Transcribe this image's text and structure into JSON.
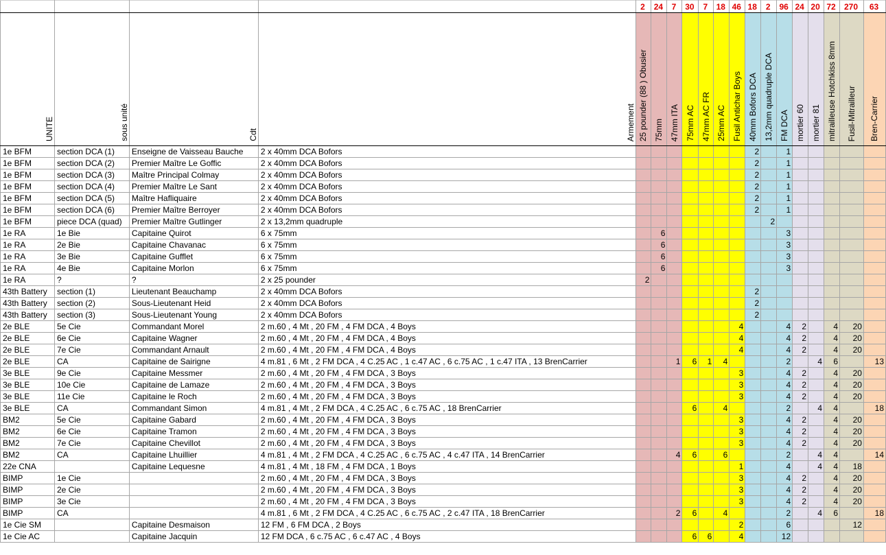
{
  "colors": {
    "pink": "#e6b8b7",
    "yellow": "#ffff00",
    "blue": "#b7dee8",
    "lavender": "#e4dfec",
    "tan": "#ddd9c4",
    "orange": "#fcd5b4",
    "totals": "#e00000"
  },
  "headers": {
    "unite": "UNITE",
    "sous_unite": "sous unité",
    "cdt": "Cdt",
    "armement": "Armement"
  },
  "weapons": [
    {
      "label": "25 pounder (88 ) Obusier",
      "total": "2",
      "color": "pink"
    },
    {
      "label": "75mm",
      "total": "24",
      "color": "pink"
    },
    {
      "label": "47mm ITA",
      "total": "7",
      "color": "pink"
    },
    {
      "label": "75mm AC",
      "total": "30",
      "color": "yellow"
    },
    {
      "label": "47mm AC FR",
      "total": "7",
      "color": "yellow"
    },
    {
      "label": "25mm AC",
      "total": "18",
      "color": "yellow"
    },
    {
      "label": "Fusil Antichar Boys",
      "total": "46",
      "color": "yellow"
    },
    {
      "label": "40mm Bofors DCA",
      "total": "18",
      "color": "blue"
    },
    {
      "label": "13,2mm quadruple DCA",
      "total": "2",
      "color": "blue"
    },
    {
      "label": "FM DCA",
      "total": "96",
      "color": "blue"
    },
    {
      "label": "mortier 60",
      "total": "24",
      "color": "lavender"
    },
    {
      "label": "mortier 81",
      "total": "20",
      "color": "lavender"
    },
    {
      "label": "mitrailleuse Hotchkiss 8mm",
      "total": "72",
      "color": "tan"
    },
    {
      "label": "Fusil-Mitrailleur",
      "total": "270",
      "color": "tan"
    },
    {
      "label": "Bren-Carrier",
      "total": "63",
      "color": "orange"
    }
  ],
  "rows": [
    {
      "unite": "1e BFM",
      "sous": "section DCA (1)",
      "cdt": "Enseigne de Vaisseau Bauche",
      "arm": "2 x 40mm DCA Bofors",
      "v": [
        "",
        "",
        "",
        "",
        "",
        "",
        "",
        "2",
        "",
        "1",
        "",
        "",
        "",
        "",
        ""
      ]
    },
    {
      "unite": "1e BFM",
      "sous": "section DCA (2)",
      "cdt": "Premier Maître Le Goffic",
      "arm": "2 x 40mm DCA Bofors",
      "v": [
        "",
        "",
        "",
        "",
        "",
        "",
        "",
        "2",
        "",
        "1",
        "",
        "",
        "",
        "",
        ""
      ]
    },
    {
      "unite": "1e BFM",
      "sous": "section DCA (3)",
      "cdt": "Maître Principal Colmay",
      "arm": "2 x 40mm DCA Bofors",
      "v": [
        "",
        "",
        "",
        "",
        "",
        "",
        "",
        "2",
        "",
        "1",
        "",
        "",
        "",
        "",
        ""
      ]
    },
    {
      "unite": "1e BFM",
      "sous": "section DCA (4)",
      "cdt": "Premier Maître Le Sant",
      "arm": "2 x 40mm DCA Bofors",
      "v": [
        "",
        "",
        "",
        "",
        "",
        "",
        "",
        "2",
        "",
        "1",
        "",
        "",
        "",
        "",
        ""
      ]
    },
    {
      "unite": "1e BFM",
      "sous": "section DCA (5)",
      "cdt": "Maître Hafliquaire",
      "arm": "2 x 40mm DCA Bofors",
      "v": [
        "",
        "",
        "",
        "",
        "",
        "",
        "",
        "2",
        "",
        "1",
        "",
        "",
        "",
        "",
        ""
      ]
    },
    {
      "unite": "1e BFM",
      "sous": "section DCA (6)",
      "cdt": "Premier Maître Berroyer",
      "arm": "2 x 40mm DCA Bofors",
      "v": [
        "",
        "",
        "",
        "",
        "",
        "",
        "",
        "2",
        "",
        "1",
        "",
        "",
        "",
        "",
        ""
      ]
    },
    {
      "unite": "1e BFM",
      "sous": "piece DCA (quad)",
      "cdt": "Premier Maître Gutlinger",
      "arm": "2 x 13,2mm quadruple",
      "v": [
        "",
        "",
        "",
        "",
        "",
        "",
        "",
        "",
        "2",
        "",
        "",
        "",
        "",
        "",
        ""
      ]
    },
    {
      "unite": "1e RA",
      "sous": "1e Bie",
      "cdt": "Capitaine Quirot",
      "arm": "6 x 75mm",
      "v": [
        "",
        "6",
        "",
        "",
        "",
        "",
        "",
        "",
        "",
        "3",
        "",
        "",
        "",
        "",
        ""
      ]
    },
    {
      "unite": "1e RA",
      "sous": "2e Bie",
      "cdt": "Capitaine Chavanac",
      "arm": "6 x 75mm",
      "v": [
        "",
        "6",
        "",
        "",
        "",
        "",
        "",
        "",
        "",
        "3",
        "",
        "",
        "",
        "",
        ""
      ]
    },
    {
      "unite": "1e RA",
      "sous": "3e Bie",
      "cdt": "Capitaine Gufflet",
      "arm": "6 x 75mm",
      "v": [
        "",
        "6",
        "",
        "",
        "",
        "",
        "",
        "",
        "",
        "3",
        "",
        "",
        "",
        "",
        ""
      ]
    },
    {
      "unite": "1e RA",
      "sous": "4e Bie",
      "cdt": "Capitaine Morlon",
      "arm": "6 x 75mm",
      "v": [
        "",
        "6",
        "",
        "",
        "",
        "",
        "",
        "",
        "",
        "3",
        "",
        "",
        "",
        "",
        ""
      ]
    },
    {
      "unite": "1e RA",
      "sous": "?",
      "cdt": "?",
      "arm": "2 x 25 pounder",
      "v": [
        "2",
        "",
        "",
        "",
        "",
        "",
        "",
        "",
        "",
        "",
        "",
        "",
        "",
        "",
        ""
      ]
    },
    {
      "unite": "43th Battery",
      "sous": "section (1)",
      "cdt": "Lieutenant Beauchamp",
      "arm": "2 x 40mm DCA Bofors",
      "v": [
        "",
        "",
        "",
        "",
        "",
        "",
        "",
        "2",
        "",
        "",
        "",
        "",
        "",
        "",
        ""
      ]
    },
    {
      "unite": "43th Battery",
      "sous": "section (2)",
      "cdt": "Sous-Lieutenant Heid",
      "arm": "2 x 40mm DCA Bofors",
      "v": [
        "",
        "",
        "",
        "",
        "",
        "",
        "",
        "2",
        "",
        "",
        "",
        "",
        "",
        "",
        ""
      ]
    },
    {
      "unite": "43th Battery",
      "sous": "section (3)",
      "cdt": "Sous-Lieutenant Young",
      "arm": "2 x 40mm DCA Bofors",
      "v": [
        "",
        "",
        "",
        "",
        "",
        "",
        "",
        "2",
        "",
        "",
        "",
        "",
        "",
        "",
        ""
      ]
    },
    {
      "unite": "2e BLE",
      "sous": "5e Cie",
      "cdt": "Commandant Morel",
      "arm": "2 m.60 , 4 Mt , 20 FM , 4 FM DCA , 4 Boys",
      "v": [
        "",
        "",
        "",
        "",
        "",
        "",
        "4",
        "",
        "",
        "4",
        "2",
        "",
        "4",
        "20",
        ""
      ]
    },
    {
      "unite": "2e BLE",
      "sous": "6e Cie",
      "cdt": "Capitaine Wagner",
      "arm": "2 m.60 , 4 Mt , 20 FM , 4 FM DCA , 4 Boys",
      "v": [
        "",
        "",
        "",
        "",
        "",
        "",
        "4",
        "",
        "",
        "4",
        "2",
        "",
        "4",
        "20",
        ""
      ]
    },
    {
      "unite": "2e BLE",
      "sous": "7e Cie",
      "cdt": "Commandant Arnault",
      "arm": "2 m.60 , 4 Mt , 20 FM , 4 FM DCA , 4 Boys",
      "v": [
        "",
        "",
        "",
        "",
        "",
        "",
        "4",
        "",
        "",
        "4",
        "2",
        "",
        "4",
        "20",
        ""
      ]
    },
    {
      "unite": "2e BLE",
      "sous": "CA",
      "cdt": "Capitaine de Sairigne",
      "arm": "4 m.81 , 6 Mt , 2 FM DCA , 4 C.25 AC , 1 c.47 AC , 6 c.75 AC , 1 c.47 ITA , 13 BrenCarrier",
      "v": [
        "",
        "",
        "1",
        "6",
        "1",
        "4",
        "",
        "",
        "",
        "2",
        "",
        "4",
        "6",
        "",
        "13"
      ]
    },
    {
      "unite": "3e BLE",
      "sous": "9e Cie",
      "cdt": "Capitaine Messmer",
      "arm": "2 m.60 , 4 Mt , 20 FM , 4 FM DCA , 3 Boys",
      "v": [
        "",
        "",
        "",
        "",
        "",
        "",
        "3",
        "",
        "",
        "4",
        "2",
        "",
        "4",
        "20",
        ""
      ]
    },
    {
      "unite": "3e BLE",
      "sous": "10e Cie",
      "cdt": "Capitaine de Lamaze",
      "arm": "2 m.60 , 4 Mt , 20 FM , 4 FM DCA , 3 Boys",
      "v": [
        "",
        "",
        "",
        "",
        "",
        "",
        "3",
        "",
        "",
        "4",
        "2",
        "",
        "4",
        "20",
        ""
      ]
    },
    {
      "unite": "3e BLE",
      "sous": "11e Cie",
      "cdt": "Capitaine le Roch",
      "arm": "2 m.60 , 4 Mt , 20 FM , 4 FM DCA , 3 Boys",
      "v": [
        "",
        "",
        "",
        "",
        "",
        "",
        "3",
        "",
        "",
        "4",
        "2",
        "",
        "4",
        "20",
        ""
      ]
    },
    {
      "unite": "3e BLE",
      "sous": "CA",
      "cdt": "Commandant Simon",
      "arm": "4 m.81 , 4 Mt , 2 FM DCA , 4 C.25 AC , 6 c.75 AC , 18 BrenCarrier",
      "v": [
        "",
        "",
        "",
        "6",
        "",
        "4",
        "",
        "",
        "",
        "2",
        "",
        "4",
        "4",
        "",
        "18"
      ]
    },
    {
      "unite": "BM2",
      "sous": "5e Cie",
      "cdt": "Capitaine Gabard",
      "arm": "2 m.60 , 4 Mt , 20 FM , 4 FM DCA , 3 Boys",
      "v": [
        "",
        "",
        "",
        "",
        "",
        "",
        "3",
        "",
        "",
        "4",
        "2",
        "",
        "4",
        "20",
        ""
      ]
    },
    {
      "unite": "BM2",
      "sous": "6e Cie",
      "cdt": "Capitaine Tramon",
      "arm": "2 m.60 , 4 Mt , 20 FM , 4 FM DCA , 3 Boys",
      "v": [
        "",
        "",
        "",
        "",
        "",
        "",
        "3",
        "",
        "",
        "4",
        "2",
        "",
        "4",
        "20",
        ""
      ]
    },
    {
      "unite": "BM2",
      "sous": "7e Cie",
      "cdt": "Capitaine Chevillot",
      "arm": "2 m.60 , 4 Mt , 20 FM , 4 FM DCA , 3 Boys",
      "v": [
        "",
        "",
        "",
        "",
        "",
        "",
        "3",
        "",
        "",
        "4",
        "2",
        "",
        "4",
        "20",
        ""
      ]
    },
    {
      "unite": "BM2",
      "sous": "CA",
      "cdt": "Capitaine Lhuillier",
      "arm": "4 m.81 , 4 Mt , 2 FM DCA , 4 C.25 AC , 6 c.75 AC , 4 c.47 ITA , 14 BrenCarrier",
      "v": [
        "",
        "",
        "4",
        "6",
        "",
        "6",
        "",
        "",
        "",
        "2",
        "",
        "4",
        "4",
        "",
        "14"
      ]
    },
    {
      "unite": "22e CNA",
      "sous": "",
      "cdt": "Capitaine Lequesne",
      "arm": "4 m.81 , 4 Mt , 18 FM , 4 FM DCA , 1 Boys",
      "v": [
        "",
        "",
        "",
        "",
        "",
        "",
        "1",
        "",
        "",
        "4",
        "",
        "4",
        "4",
        "18",
        ""
      ]
    },
    {
      "unite": "BIMP",
      "sous": "1e Cie",
      "cdt": "",
      "arm": "2 m.60 , 4 Mt , 20 FM , 4 FM DCA , 3 Boys",
      "v": [
        "",
        "",
        "",
        "",
        "",
        "",
        "3",
        "",
        "",
        "4",
        "2",
        "",
        "4",
        "20",
        ""
      ]
    },
    {
      "unite": "BIMP",
      "sous": "2e Cie",
      "cdt": "",
      "arm": "2 m.60 , 4 Mt , 20 FM , 4 FM DCA , 3 Boys",
      "v": [
        "",
        "",
        "",
        "",
        "",
        "",
        "3",
        "",
        "",
        "4",
        "2",
        "",
        "4",
        "20",
        ""
      ]
    },
    {
      "unite": "BIMP",
      "sous": "3e Cie",
      "cdt": "",
      "arm": "2 m.60 , 4 Mt , 20 FM , 4 FM DCA , 3 Boys",
      "v": [
        "",
        "",
        "",
        "",
        "",
        "",
        "3",
        "",
        "",
        "4",
        "2",
        "",
        "4",
        "20",
        ""
      ]
    },
    {
      "unite": "BIMP",
      "sous": "CA",
      "cdt": "",
      "arm": "4 m.81 , 6 Mt , 2 FM DCA , 4 C.25 AC , 6 c.75 AC , 2 c.47 ITA , 18 BrenCarrier",
      "v": [
        "",
        "",
        "2",
        "6",
        "",
        "4",
        "",
        "",
        "",
        "2",
        "",
        "4",
        "6",
        "",
        "18"
      ]
    },
    {
      "unite": "1e Cie SM",
      "sous": "",
      "cdt": "Capitaine Desmaison",
      "arm": "12 FM , 6 FM DCA , 2 Boys",
      "v": [
        "",
        "",
        "",
        "",
        "",
        "",
        "2",
        "",
        "",
        "6",
        "",
        "",
        "",
        "12",
        ""
      ]
    },
    {
      "unite": "1e Cie AC",
      "sous": "",
      "cdt": "Capitaine Jacquin",
      "arm": "12 FM DCA , 6 c.75 AC , 6 c.47 AC , 4 Boys",
      "v": [
        "",
        "",
        "",
        "6",
        "6",
        "",
        "4",
        "",
        "",
        "12",
        "",
        "",
        "",
        "",
        ""
      ]
    }
  ]
}
